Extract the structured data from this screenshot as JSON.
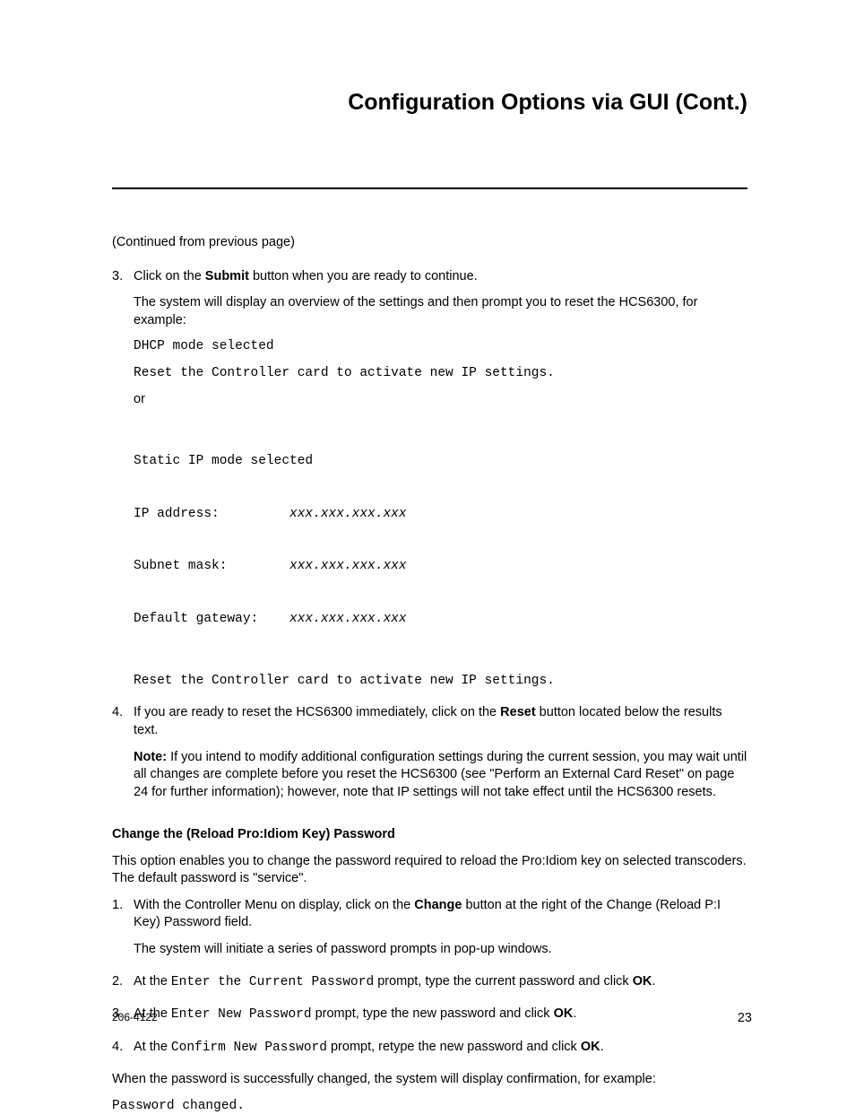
{
  "title": "Configuration Options via GUI (Cont.)",
  "continued": "(Continued from previous page)",
  "step3": {
    "num": "3.",
    "line1_a": "Click on the ",
    "line1_b": "Submit",
    "line1_c": " button when you are ready to continue.",
    "line2": "The system will display an overview of the settings and then prompt you to reset the HCS6300, for example:",
    "mono1_l1": "DHCP mode selected",
    "mono1_l2": "Reset the Controller card to activate new IP settings.",
    "or": "or",
    "mono2_l1": "Static IP mode selected",
    "mono2_l2a": "IP address:         ",
    "mono2_l2b": "xxx.xxx.xxx.xxx",
    "mono2_l3a": "Subnet mask:        ",
    "mono2_l3b": "xxx.xxx.xxx.xxx",
    "mono2_l4a": "Default gateway:    ",
    "mono2_l4b": "xxx.xxx.xxx.xxx",
    "mono2_l5": "Reset the Controller card to activate new IP settings."
  },
  "step4": {
    "num": "4.",
    "line1_a": "If you are ready to reset the HCS6300 immediately, click on the ",
    "line1_b": "Reset",
    "line1_c": " button located below the results text.",
    "note_b": "Note:",
    "note_t": " If you intend to modify additional configuration settings during the current session, you may wait until all changes are complete before you reset the HCS6300 (see \"Perform an External Card Reset\" on page 24 for further information); however, note that IP settings will not take effect until the HCS6300 resets."
  },
  "sub_heading": "Change the (Reload Pro:Idiom Key) Password",
  "sub_intro": "This option enables you to change the password required to reload the Pro:Idiom key on selected transcoders. The default password is \"service\".",
  "s1": {
    "num": "1.",
    "a": "With the Controller Menu on display, click on the ",
    "b": "Change",
    "c": " button at the right of the Change (Reload P:I Key) Password field.",
    "d": "The system will initiate a series of password prompts in pop-up windows."
  },
  "s2": {
    "num": "2.",
    "a": "At the ",
    "m": "Enter the Current Password",
    "c": " prompt, type the current password and click ",
    "b": "OK",
    "e": "."
  },
  "s3": {
    "num": "3.",
    "a": "At the ",
    "m": "Enter New Password",
    "c": " prompt, type the new password and click ",
    "b": "OK",
    "e": "."
  },
  "s4": {
    "num": "4.",
    "a": "At the ",
    "m": "Confirm New Password",
    "c": " prompt, retype the new password and click ",
    "b": "OK",
    "e": "."
  },
  "closing": "When the password is successfully changed, the system will display confirmation, for example:",
  "closing_mono": "Password changed.",
  "footer_left": "206-4122",
  "footer_right": "23"
}
